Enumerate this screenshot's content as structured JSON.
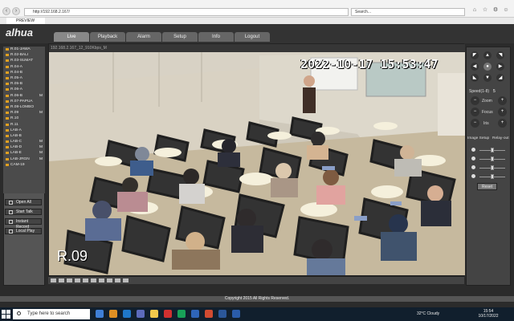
{
  "browser": {
    "url": "http://192.168.2.167/",
    "search_placeholder": "Search...",
    "tab_title": "PREVIEW"
  },
  "app": {
    "logo": "alhua",
    "menu": [
      "Live",
      "Playback",
      "Alarm",
      "Setup",
      "Info",
      "Logout"
    ],
    "copyright": "Copyright 2015 All Rights Reserved."
  },
  "channels": [
    {
      "label": "R.01-JAWA",
      "extra": ""
    },
    {
      "label": "R.02-BALI",
      "extra": ""
    },
    {
      "label": "R.03-SUMAT",
      "extra": ""
    },
    {
      "label": "R.04-A",
      "extra": ""
    },
    {
      "label": "R.04-B",
      "extra": ""
    },
    {
      "label": "R.05-A",
      "extra": ""
    },
    {
      "label": "R.05-B",
      "extra": ""
    },
    {
      "label": "R.06-A",
      "extra": ""
    },
    {
      "label": "R.06-B",
      "extra": "M"
    },
    {
      "label": "R.07-PAPUA",
      "extra": ""
    },
    {
      "label": "R.08-LOMBO",
      "extra": ""
    },
    {
      "label": "R.09",
      "extra": "M"
    },
    {
      "label": "R.10",
      "extra": ""
    },
    {
      "label": "R.11",
      "extra": ""
    },
    {
      "label": "LAB-A",
      "extra": ""
    },
    {
      "label": "LAB-B",
      "extra": ""
    },
    {
      "label": "LAB-C",
      "extra": "M"
    },
    {
      "label": "LAB-D",
      "extra": "M"
    },
    {
      "label": "LAB-E",
      "extra": "M"
    },
    {
      "label": "LAB-JRGN",
      "extra": "M"
    },
    {
      "label": "CAM-19",
      "extra": ""
    }
  ],
  "side_buttons": [
    "Open All",
    "Start Talk",
    "Instant Record",
    "Local Play"
  ],
  "video": {
    "header": "192.168.2.167_12_910Kbps_M",
    "timestamp": "2022-10-17 15:53:47",
    "camera_label": "R.09"
  },
  "ptz": {
    "speed_label": "Speed(1-8)",
    "speed_value": "5",
    "zoom": "Zoom",
    "focus": "Focus",
    "iris": "Iris",
    "image_setup": "Image Setup",
    "relay_out": "Relay-out",
    "reset": "Reset"
  },
  "taskbar": {
    "search": "Type here to search",
    "weather": "32°C Cloudy",
    "time": "15:54",
    "date": "10/17/2022"
  },
  "colors": {
    "accent": "#e0a020",
    "header": "#333333",
    "panel": "#444444"
  }
}
